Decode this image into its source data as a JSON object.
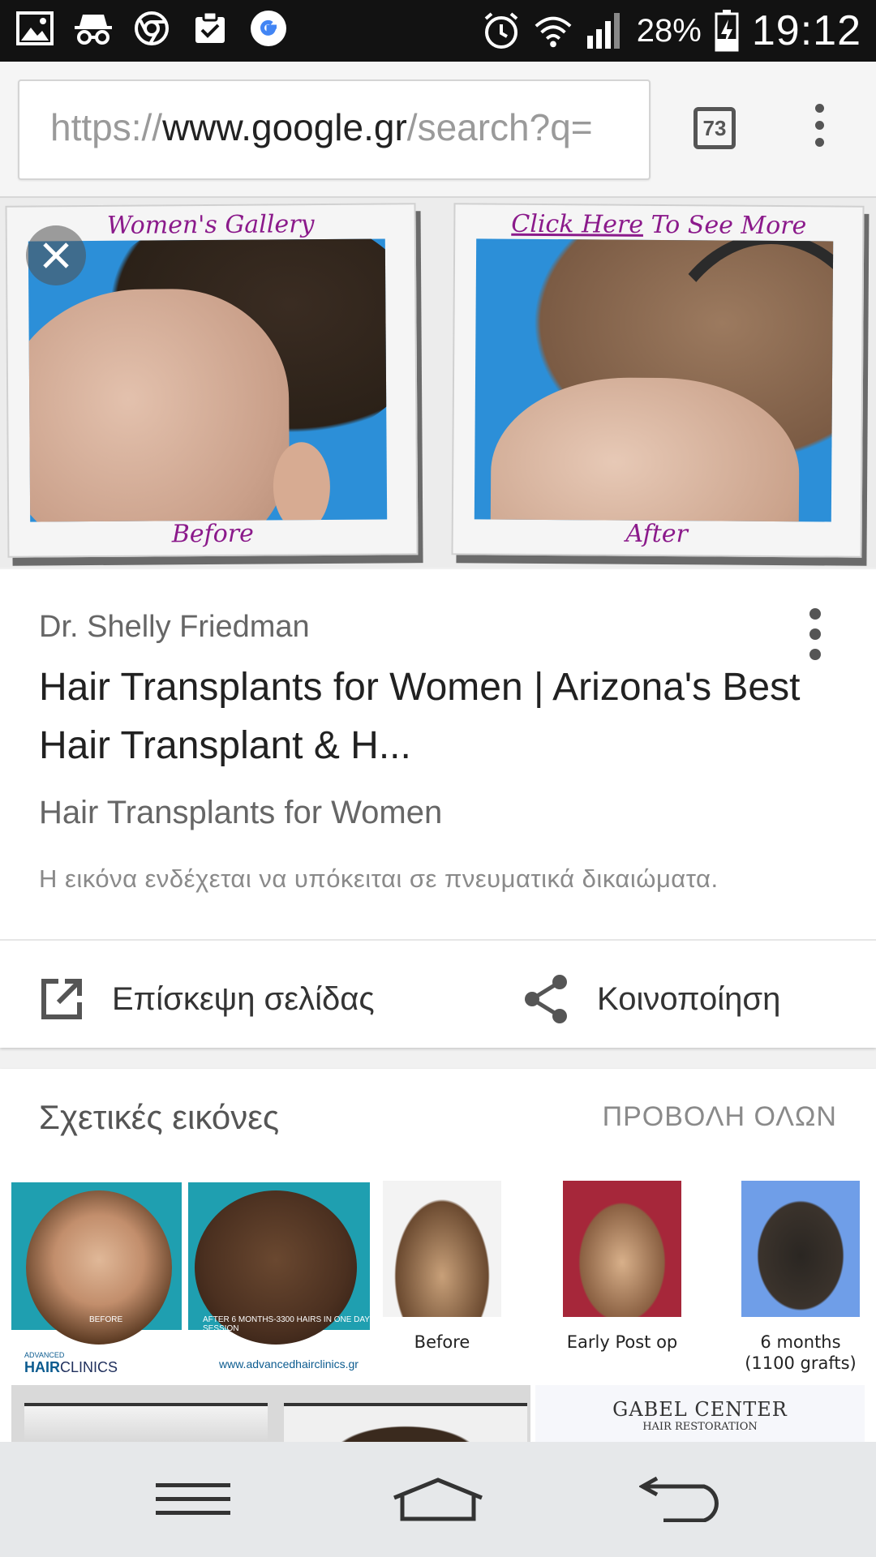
{
  "status_bar": {
    "battery_percent": "28%",
    "time": "19:12",
    "left_icons": [
      "gallery-icon",
      "incognito-icon",
      "chrome-icon",
      "clipboard-check-icon",
      "google-icon"
    ],
    "right_icons": [
      "alarm-icon",
      "wifi-icon",
      "signal-icon",
      "battery-charging-icon"
    ]
  },
  "browser": {
    "url_scheme": "https://",
    "url_host": "www.google.gr",
    "url_path": "/search?q=",
    "tab_count": "73"
  },
  "hero": {
    "left_top_caption": "Women's Gallery",
    "left_bottom_caption": "Before",
    "right_top_caption_link": "Click Here",
    "right_top_caption_rest": " To See More",
    "right_bottom_caption": "After"
  },
  "result": {
    "source": "Dr. Shelly Friedman",
    "title": "Hair Transplants for Women | Arizona's Best Hair Transplant & H...",
    "subtitle": "Hair Transplants for Women",
    "copyright_notice": "Η εικόνα ενδέχεται να υπόκειται σε πνευματικά δικαιώματα.",
    "visit_label": "Επίσκεψη σελίδας",
    "share_label": "Κοινοποίηση"
  },
  "related": {
    "title": "Σχετικές εικόνες",
    "view_all": "ΠΡΟΒΟΛΗ ΟΛΩΝ",
    "thumb1": {
      "caption_before": "BEFORE",
      "caption_after": "AFTER 6 MONTHS-3300 HAIRS IN ONE DAY SESSION",
      "brand_top": "ADVANCED",
      "brand_main": "HAIR",
      "brand_main_rest": "CLINICS",
      "site": "www.advancedhairclinics.gr"
    },
    "thumb2_caption": "Before",
    "thumb3_caption": "Early Post op",
    "thumb4_caption_line1": "6 months",
    "thumb4_caption_line2": "(1100 grafts)",
    "thumb6_title": "GABEL CENTER",
    "thumb6_subtitle": "HAIR RESTORATION"
  }
}
